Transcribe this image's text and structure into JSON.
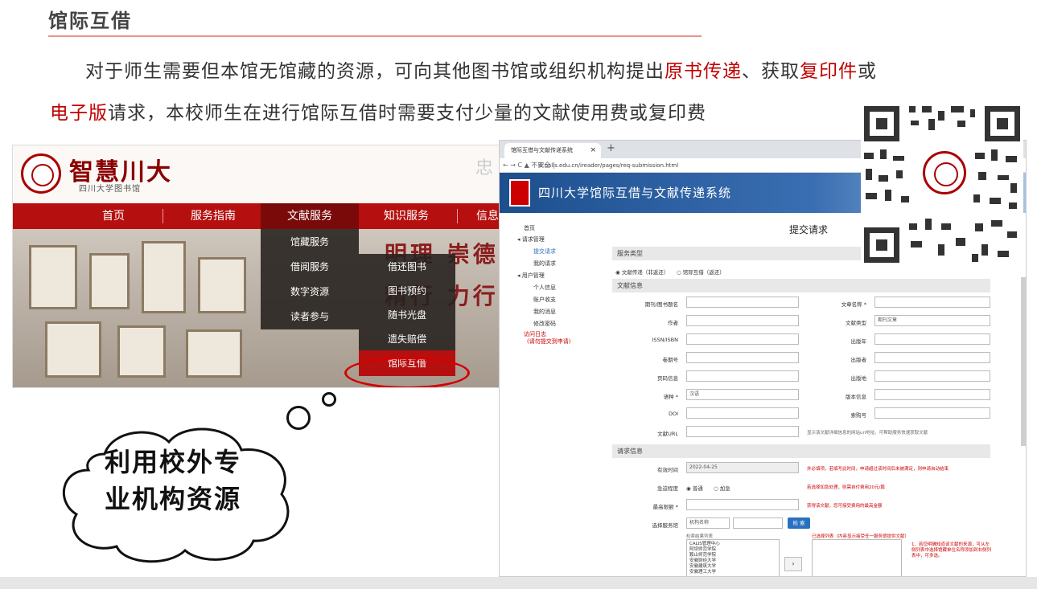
{
  "slide": {
    "title": "馆际互借",
    "para1_a": "对于师生需要但本馆无馆藏的资源，可向其他图书馆或组织机构提出",
    "para1_hl1": "原书传递",
    "para1_b": "、获取",
    "para1_hl2": "复印件",
    "para1_c": "或",
    "para2_hl": "电子版",
    "para2_b": "请求，本校师生在进行馆际互借时需要支付少量的文献使用费或复印费",
    "bubble_line1": "利用校外专",
    "bubble_line2": "业机构资源"
  },
  "library_site": {
    "logo": "智慧川大",
    "subtitle": "四川大学图书馆",
    "motto_char": "忠",
    "nav": [
      "首页",
      "服务指南",
      "文献服务",
      "知识服务",
      "信息"
    ],
    "wall_text1": "明理 崇德",
    "wall_text2": "精行 力行",
    "menu1": [
      "馆藏服务",
      "借阅服务",
      "数字资源",
      "读者参与"
    ],
    "menu2": [
      "借还图书",
      "图书预约",
      "随书光盘",
      "遗失赔偿",
      "馆际互借"
    ]
  },
  "ill_system": {
    "tab_title": "馆际互借与文献传递系统",
    "tab_close": "×",
    "tab_plus": "+",
    "addr_nav": "←  →  C  ▲ 不安全 |",
    "url": "ill.calis.edu.cn/ireader/pages/req-submission.html",
    "header_title": "四川大学馆际互借与文献传递系统",
    "sidebar": {
      "home": "首页",
      "req_mgmt": "◂ 请求管理",
      "submit_req": "提交请求",
      "my_req": "我的请求",
      "user_mgmt": "◂ 用户管理",
      "profile": "个人信息",
      "account": "账户收支",
      "messages": "我的消息",
      "password": "修改密码",
      "visit_log1": "访问日志",
      "visit_log2": "(请勿提交到申请)"
    },
    "page_title": "提交请求",
    "section_service": "服务类型",
    "service_opt1": "◉ 文献传递（非返还）",
    "service_opt2": "○ 馆际互借（返还）",
    "section_doc": "文献信息",
    "labels": {
      "journal": "期刊/图书题名",
      "article": "文章名称 *",
      "author": "作者",
      "doctype": "文献类型",
      "issn": "ISSN/ISBN",
      "pubyear": "出版年",
      "volume": "卷期号",
      "publisher": "出版者",
      "pages": "页码信息",
      "pubplace": "出版地",
      "lang": "语种 *",
      "edition": "版本信息",
      "doi": "DOI",
      "callno": "索购号",
      "url": "文献URL"
    },
    "doctype_value": "期刊文章",
    "lang_value": "汉语",
    "url_note": "显示该文献详细信息的网站url地址。可帮助服务快速获取文献",
    "section_req": "请求信息",
    "req_labels": {
      "valid": "有效时间",
      "urgency": "急迫程度",
      "maxfee": "最高限额 *",
      "select": "选择服务馆"
    },
    "valid_value": "2022-04-25",
    "valid_note": "并必填项，若填写此时间，申请超过该时间后未被满足，则申请自动结束",
    "urgency_opt1": "◉ 普通",
    "urgency_opt2": "○ 加急",
    "urgency_note": "若选择加急处理，则需自付费用20元/篇",
    "maxfee_note": "获得该文献，您可接受费用的最高金额",
    "select_value": "机构名称",
    "search_btn": "检 索",
    "result_label": "检索结果列表",
    "result_items": [
      "CALIS管理中心",
      "阿坝师范学院",
      "鞍山师范学院",
      "安徽财经大学",
      "安徽建筑大学",
      "安徽理工大学"
    ],
    "chosen_label": "已选择列表（内容显示接受任一服务馆提供文献）",
    "arrow": "›",
    "side_note": "1、若您明确知道该文献的来源，可从左侧列表中选择馆藏单位名称添加到右侧列表中，可多选。"
  },
  "colors": {
    "accent_red": "#c00000",
    "nav_red": "#b5100f",
    "title_line": "#e8958c",
    "system_blue": "#1d4f8e"
  }
}
